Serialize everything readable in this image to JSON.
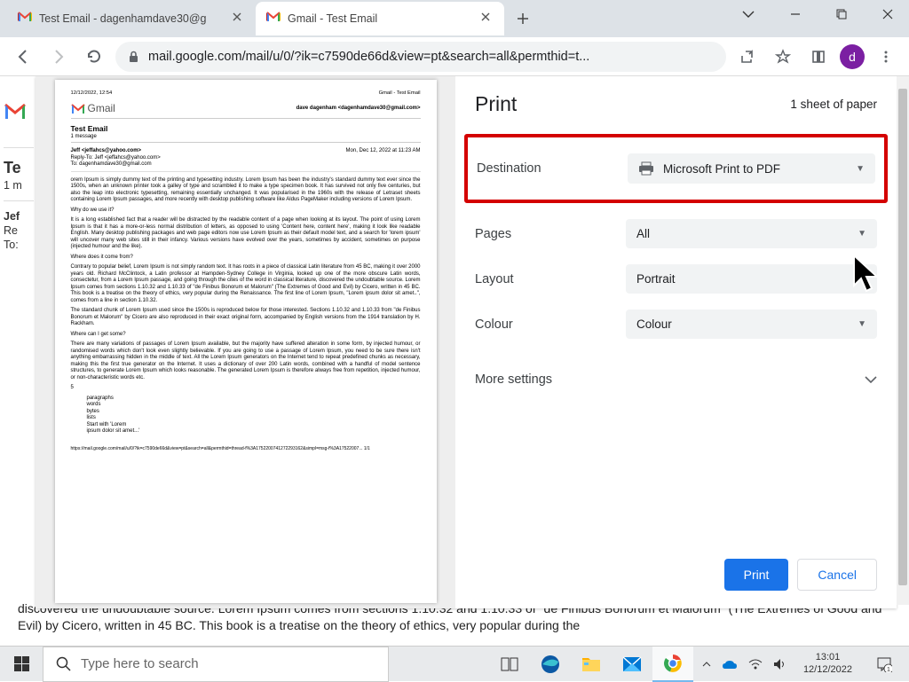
{
  "browser": {
    "tabs": [
      {
        "title": "Test Email - dagenhamdave30@g"
      },
      {
        "title": "Gmail - Test Email"
      }
    ],
    "url": "mail.google.com/mail/u/0/?ik=c7590de66d&view=pt&search=all&permthid=t...",
    "avatar_letter": "d"
  },
  "gmail_bg": {
    "title": "Te",
    "count": "1 m",
    "from": "Jef",
    "reply": "Re",
    "to": "To:"
  },
  "bg_paragraph": "discovered the undoubtable source. Lorem Ipsum comes from sections 1.10.32 and 1.10.33 of \"de Finibus Bonorum et Malorum\" (The Extremes of Good and Evil) by Cicero, written in 45 BC. This book is a treatise on the theory of ethics, very popular during the",
  "print": {
    "title": "Print",
    "sheets": "1 sheet of paper",
    "settings": {
      "destination_label": "Destination",
      "destination_value": "Microsoft Print to PDF",
      "pages_label": "Pages",
      "pages_value": "All",
      "layout_label": "Layout",
      "layout_value": "Portrait",
      "colour_label": "Colour",
      "colour_value": "Colour",
      "more": "More settings"
    },
    "buttons": {
      "print": "Print",
      "cancel": "Cancel"
    }
  },
  "preview": {
    "timestamp": "12/12/2022, 12:54",
    "header_title": "Gmail - Test Email",
    "brand": "Gmail",
    "sender": "dave dagenham <dagenhamdave30@gmail.com>",
    "subject": "Test Email",
    "msg_count": "1 message",
    "from": "Jeff <jeffahcs@yahoo.com>",
    "reply": "Reply-To: Jeff <jeffahcs@yahoo.com>",
    "to": "To: dagenhamdave30@gmail.com",
    "date": "Mon, Dec 12, 2022 at 11:23 AM",
    "body1": "orem Ipsum is simply dummy text of the printing and typesetting industry. Lorem Ipsum has been the industry's standard dummy text ever since the 1500s, when an unknown printer took a galley of type and scrambled it to make a type specimen book. It has survived not only five centuries, but also the leap into electronic typesetting, remaining essentially unchanged. It was popularised in the 1960s with the release of Letraset sheets containing Lorem Ipsum passages, and more recently with desktop publishing software like Aldus PageMaker including versions of Lorem Ipsum.",
    "h2": "Why do we use it?",
    "body2": "It is a long established fact that a reader will be distracted by the readable content of a page when looking at its layout. The point of using Lorem Ipsum is that it has a more-or-less normal distribution of letters, as opposed to using 'Content here, content here', making it look like readable English. Many desktop publishing packages and web page editors now use Lorem Ipsum as their default model text, and a search for 'lorem ipsum' will uncover many web sites still in their infancy. Various versions have evolved over the years, sometimes by accident, sometimes on purpose (injected humour and the like).",
    "h3": "Where does it come from?",
    "body3": "Contrary to popular belief, Lorem Ipsum is not simply random text. It has roots in a piece of classical Latin literature from 45 BC, making it over 2000 years old. Richard McClintock, a Latin professor at Hampden-Sydney College in Virginia, looked up one of the more obscure Latin words, consectetur, from a Lorem Ipsum passage, and going through the cites of the word in classical literature, discovered the undoubtable source. Lorem Ipsum comes from sections 1.10.32 and 1.10.33 of \"de Finibus Bonorum et Malorum\" (The Extremes of Good and Evil) by Cicero, written in 45 BC. This book is a treatise on the theory of ethics, very popular during the Renaissance. The first line of Lorem Ipsum, \"Lorem ipsum dolor sit amet..\", comes from a line in section 1.10.32.",
    "body4": "The standard chunk of Lorem Ipsum used since the 1500s is reproduced below for those interested. Sections 1.10.32 and 1.10.33 from \"de Finibus Bonorum et Malorum\" by Cicero are also reproduced in their exact original form, accompanied by English versions from the 1914 translation by H. Rackham.",
    "h4": "Where can I get some?",
    "body5": "There are many variations of passages of Lorem Ipsum available, but the majority have suffered alteration in some form, by injected humour, or randomised words which don't look even slightly believable. If you are going to use a passage of Lorem Ipsum, you need to be sure there isn't anything embarrassing hidden in the middle of text. All the Lorem Ipsum generators on the Internet tend to repeat predefined chunks as necessary, making this the first true generator on the Internet. It uses a dictionary of over 200 Latin words, combined with a handful of model sentence structures, to generate Lorem Ipsum which looks reasonable. The generated Lorem Ipsum is therefore always free from repetition, injected humour, or non-characteristic words etc.",
    "list_label": "5",
    "list": [
      "paragraphs",
      "words",
      "bytes",
      "lists",
      "Start with 'Lorem",
      "ipsum dolor sit amet...'"
    ],
    "footer": "https://mail.google.com/mail/u/0/?ik=c7590de66d&view=pt&search=all&permthid=thread-f%3A1752200741272293162&simpl=msg-f%3A17522007...   1/1"
  },
  "taskbar": {
    "search_placeholder": "Type here to search",
    "time": "13:01",
    "date": "12/12/2022"
  }
}
